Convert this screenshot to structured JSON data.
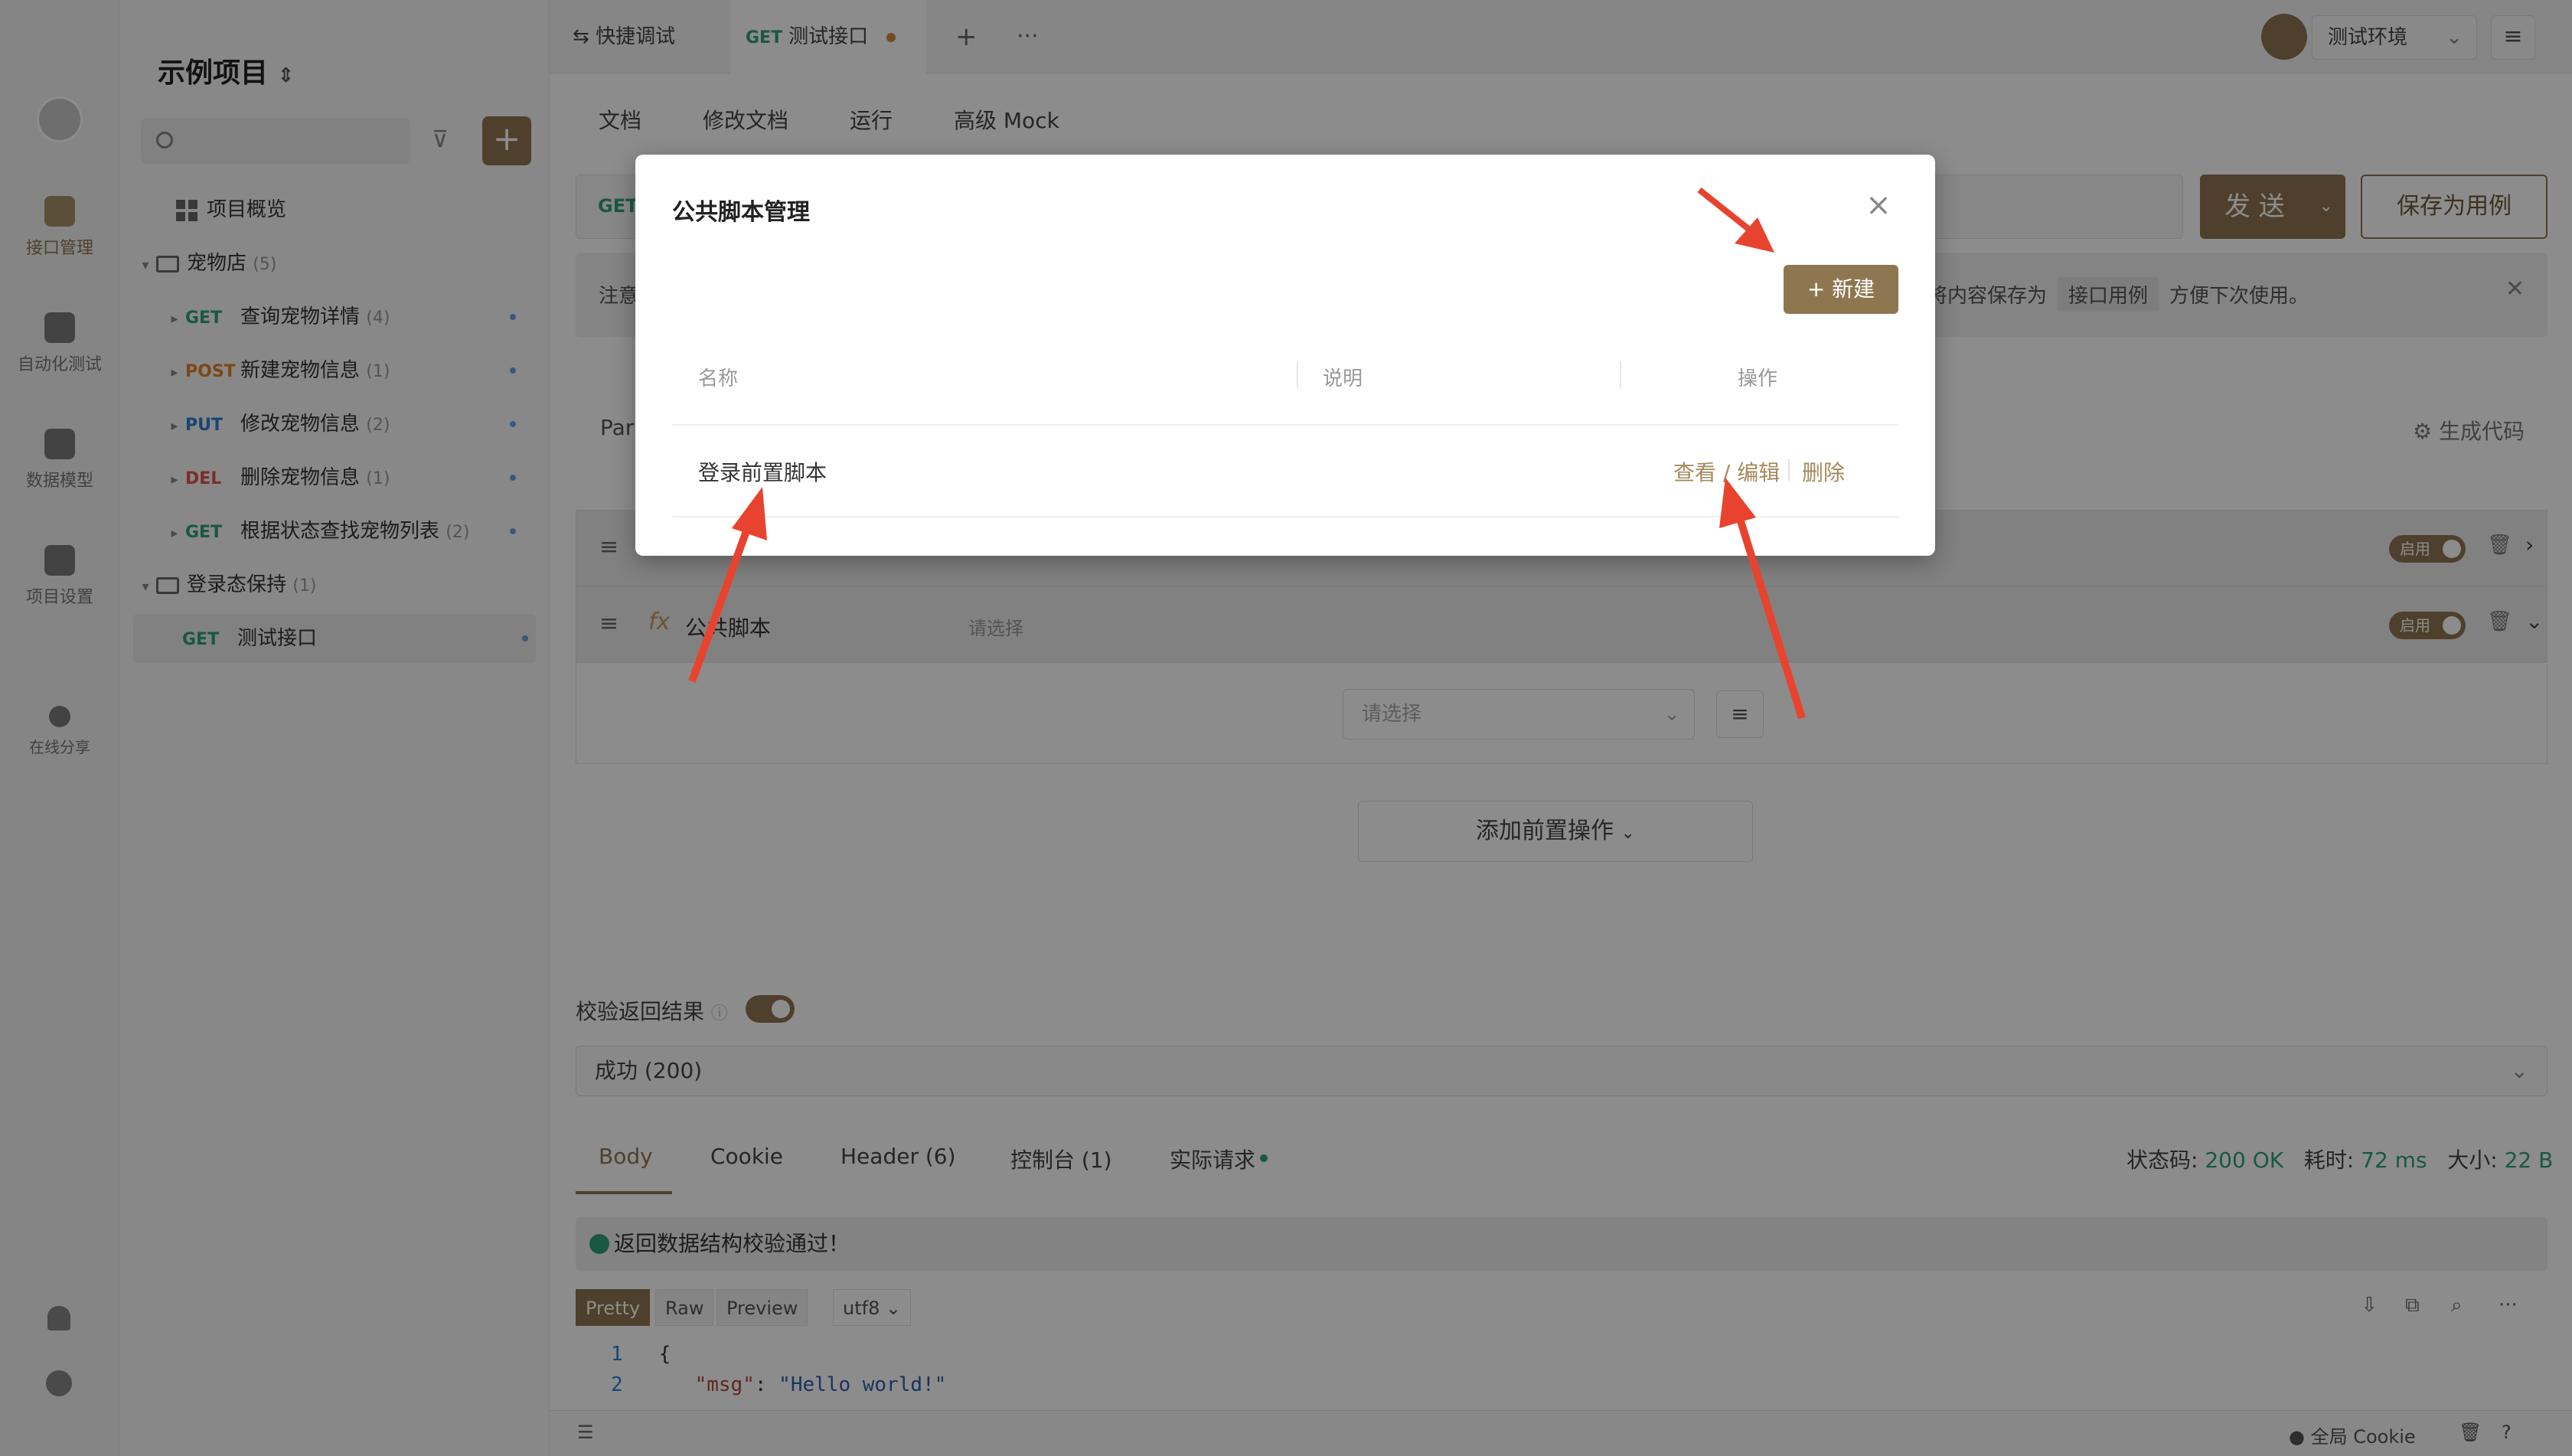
{
  "window": {
    "traffic_lights": [
      "#ff5f57",
      "#febc2e",
      "#28c840"
    ]
  },
  "rail": {
    "items": [
      {
        "label": "接口管理",
        "icon": "api-icon",
        "active": true
      },
      {
        "label": "自动化测试",
        "icon": "automation-icon",
        "active": false
      },
      {
        "label": "数据模型",
        "icon": "data-model-icon",
        "active": false
      },
      {
        "label": "项目设置",
        "icon": "settings-icon",
        "active": false
      },
      {
        "label": "在线分享",
        "icon": "share-icon",
        "active": false
      }
    ]
  },
  "tree": {
    "project_name": "示例项目",
    "overview": "项目概览",
    "folder1": {
      "name": "宠物店",
      "count": "(5)"
    },
    "items": [
      {
        "method": "GET",
        "name": "查询宠物详情",
        "count": "(4)"
      },
      {
        "method": "POST",
        "name": "新建宠物信息",
        "count": "(1)"
      },
      {
        "method": "PUT",
        "name": "修改宠物信息",
        "count": "(2)"
      },
      {
        "method": "DEL",
        "name": "删除宠物信息",
        "count": "(1)"
      },
      {
        "method": "GET",
        "name": "根据状态查找宠物列表",
        "count": "(2)"
      }
    ],
    "folder2": {
      "name": "登录态保持",
      "count": "(1)"
    },
    "selected": {
      "method": "GET",
      "name": "测试接口"
    }
  },
  "tabs": {
    "quick_debug": "快捷调试",
    "active_method": "GET",
    "active_label": "测试接口",
    "env": "测试环境"
  },
  "subtabs": [
    "文档",
    "修改文档",
    "运行",
    "高级 Mock"
  ],
  "request": {
    "method_fragment": "GET",
    "send": "发 送",
    "save_case": "保存为用例"
  },
  "notice": {
    "prefix": "注意",
    "text": "，将内容保存为",
    "chip": "接口用例",
    "suffix": "方便下次使用。"
  },
  "params": {
    "tab_fragment": "Para",
    "gen_code": "生成代码"
  },
  "pre_ops": {
    "toggle_label": "启用",
    "script_row_prefix": "fx",
    "script_row_label": "公共脚本",
    "script_row_placeholder": "请选择",
    "select_placeholder": "请选择",
    "add_button": "添加前置操作"
  },
  "response": {
    "verify_label": "校验返回结果",
    "status_select": "成功 (200)",
    "tabs": [
      {
        "label": "Body"
      },
      {
        "label": "Cookie"
      },
      {
        "label": "Header (6)"
      },
      {
        "label": "控制台 (1)"
      },
      {
        "label": "实际请求"
      }
    ],
    "status_code_label": "状态码:",
    "status_code": "200 OK",
    "time_label": "耗时:",
    "time": "72 ms",
    "size_label": "大小:",
    "size": "22 B",
    "valid_text": "返回数据结构校验通过！",
    "formats": [
      "Pretty",
      "Raw",
      "Preview"
    ],
    "encoding": "utf8",
    "code": [
      {
        "n": "1",
        "text": "{"
      },
      {
        "n": "2",
        "key": "\"msg\"",
        "value": "\"Hello world!\""
      }
    ]
  },
  "bottom": {
    "cookie": "全局 Cookie"
  },
  "modal": {
    "title": "公共脚本管理",
    "new_button": "+ 新建",
    "columns": [
      "名称",
      "说明",
      "操作"
    ],
    "rows": [
      {
        "name": "登录前置脚本",
        "desc": "",
        "view_edit": "查看 / 编辑",
        "delete": "删除"
      }
    ]
  },
  "colors": {
    "accent": "#8e7650",
    "arrow": "#e8432e",
    "get": "#2fa07a",
    "post": "#e1842a",
    "put": "#2c7fd3",
    "del": "#e15050"
  }
}
